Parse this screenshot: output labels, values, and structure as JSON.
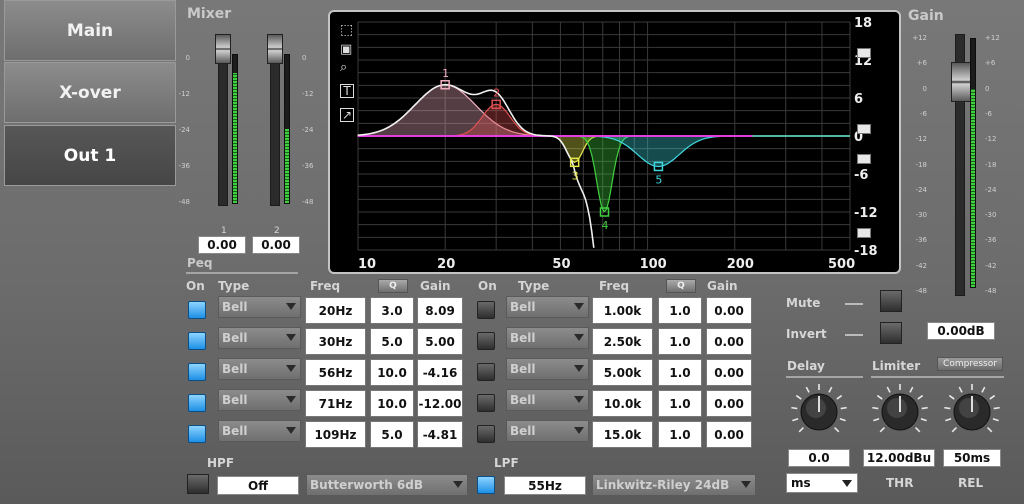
{
  "nav": {
    "main": "Main",
    "xover": "X-over",
    "out1": "Out 1"
  },
  "mixer": {
    "title": "Mixer",
    "scale": [
      "0",
      "-12",
      "-24",
      "-36",
      "-48"
    ],
    "ch1_label": "1",
    "ch2_label": "2",
    "ch1_value": "0.00",
    "ch2_value": "0.00",
    "ch1_level": 0.88,
    "ch2_level": 0.5
  },
  "gain": {
    "title": "Gain",
    "scale": [
      "+12",
      "+6",
      "0",
      "-6",
      "-12",
      "-18",
      "-24",
      "-30",
      "-36",
      "-42",
      "-48"
    ],
    "value": "0.00dB",
    "level": 0.8
  },
  "graph": {
    "right_scale": [
      "18",
      "12",
      "6",
      "0",
      "-6",
      "-12",
      "-18"
    ],
    "x_ticks": [
      "10",
      "20",
      "50",
      "100",
      "200",
      "500"
    ],
    "points": [
      {
        "id": "1",
        "freq_hz": 20,
        "gain_db": 8.09,
        "color": "#f0b0c0"
      },
      {
        "id": "2",
        "freq_hz": 30,
        "gain_db": 5.0,
        "color": "#e05050"
      },
      {
        "id": "3",
        "freq_hz": 56,
        "gain_db": -4.16,
        "color": "#e8e84a"
      },
      {
        "id": "4",
        "freq_hz": 71,
        "gain_db": -12.0,
        "color": "#40d040"
      },
      {
        "id": "5",
        "freq_hz": 109,
        "gain_db": -4.81,
        "color": "#40d8e0"
      }
    ],
    "icons": [
      "select-icon",
      "camera-icon",
      "zoom-icon",
      "text-icon",
      "export-icon"
    ]
  },
  "peq": {
    "title": "Peq",
    "headers": {
      "on": "On",
      "type": "Type",
      "freq": "Freq",
      "q": "Q",
      "gain": "Gain"
    },
    "left": [
      {
        "on": true,
        "type": "Bell",
        "freq": "20Hz",
        "q": "3.0",
        "gain": "8.09"
      },
      {
        "on": true,
        "type": "Bell",
        "freq": "30Hz",
        "q": "5.0",
        "gain": "5.00"
      },
      {
        "on": true,
        "type": "Bell",
        "freq": "56Hz",
        "q": "10.0",
        "gain": "-4.16"
      },
      {
        "on": true,
        "type": "Bell",
        "freq": "71Hz",
        "q": "10.0",
        "gain": "-12.00"
      },
      {
        "on": true,
        "type": "Bell",
        "freq": "109Hz",
        "q": "5.0",
        "gain": "-4.81"
      }
    ],
    "right": [
      {
        "on": false,
        "type": "Bell",
        "freq": "1.00k",
        "q": "1.0",
        "gain": "0.00"
      },
      {
        "on": false,
        "type": "Bell",
        "freq": "2.50k",
        "q": "1.0",
        "gain": "0.00"
      },
      {
        "on": false,
        "type": "Bell",
        "freq": "5.00k",
        "q": "1.0",
        "gain": "0.00"
      },
      {
        "on": false,
        "type": "Bell",
        "freq": "10.0k",
        "q": "1.0",
        "gain": "0.00"
      },
      {
        "on": false,
        "type": "Bell",
        "freq": "15.0k",
        "q": "1.0",
        "gain": "0.00"
      }
    ]
  },
  "hpf": {
    "label": "HPF",
    "enabled": false,
    "value": "Off",
    "filter": "Butterworth 6dB"
  },
  "lpf": {
    "label": "LPF",
    "enabled": true,
    "value": "55Hz",
    "filter": "Linkwitz-Riley 24dB"
  },
  "mute": {
    "label": "Mute"
  },
  "invert": {
    "label": "Invert"
  },
  "delay": {
    "title": "Delay",
    "value": "0.0",
    "unit": "ms"
  },
  "limiter": {
    "title": "Limiter",
    "compressor": "Compressor",
    "thr_value": "12.00dBu",
    "thr_label": "THR",
    "rel_value": "50ms",
    "rel_label": "REL"
  }
}
